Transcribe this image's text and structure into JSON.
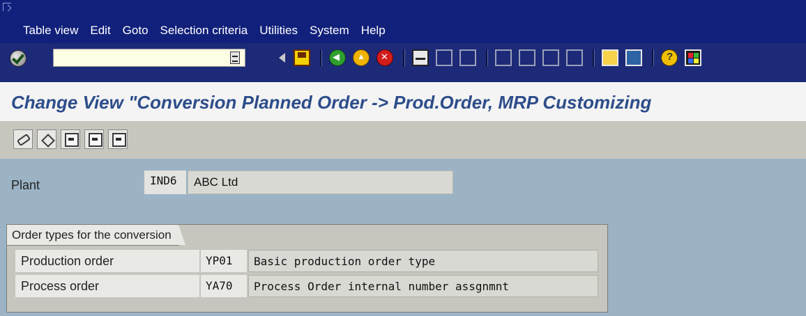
{
  "menubar": {
    "items": [
      "Table view",
      "Edit",
      "Goto",
      "Selection criteria",
      "Utilities",
      "System",
      "Help"
    ]
  },
  "toolbar": {
    "command_field_value": "",
    "icons": [
      "ok-check-icon",
      "command-history-icon",
      "back-triangle-icon",
      "save-icon",
      "back-green-icon",
      "exit-yellow-icon",
      "cancel-red-icon",
      "print-icon",
      "find-icon",
      "find-next-icon",
      "first-page-icon",
      "previous-page-icon",
      "next-page-icon",
      "last-page-icon",
      "create-session-icon",
      "create-shortcut-icon",
      "help-icon",
      "layout-menu-icon"
    ]
  },
  "title": "Change View \"Conversion Planned Order -> Prod.Order, MRP Customizing",
  "app_toolbar": {
    "icons": [
      "display-change-icon",
      "undo-icon",
      "previous-entry-icon",
      "next-entry-icon",
      "variable-list-icon"
    ]
  },
  "plant": {
    "label": "Plant",
    "code": "IND6",
    "name": "ABC Ltd"
  },
  "order_types": {
    "title": "Order types for the conversion",
    "rows": [
      {
        "label": "Production order",
        "code": "YP01",
        "description": "Basic production order type"
      },
      {
        "label": "Process order",
        "code": "YA70",
        "description": "Process Order internal number assgnmnt"
      }
    ]
  },
  "colors": {
    "menubar_bg": "#11207a",
    "toolbar_bg": "#1d2a78",
    "title_color": "#2d4d8a",
    "page_bg": "#9bb3c5",
    "group_bg": "#c6c6bf"
  }
}
